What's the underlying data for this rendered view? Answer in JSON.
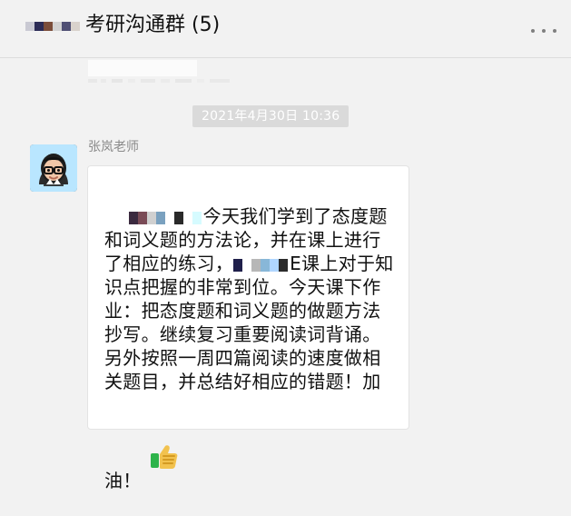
{
  "header": {
    "title": "考研沟通群 (5)",
    "more_icon": "ellipsis-horizontal-icon"
  },
  "timestamp": {
    "text": "2021年4月30日 10:36"
  },
  "message": {
    "sender_name": "张岚老师",
    "avatar_icon": "teacher-avatar-icon",
    "text_parts": [
      {
        "type": "mention_redacted"
      },
      {
        "type": "text",
        "value": "今天我们学到了态度题和词义题的方法论，并在课上进行了相应的练习，"
      },
      {
        "type": "mention_redacted"
      },
      {
        "type": "text",
        "value": "E课上对于知识点把握的非常到位。今天课下作业：把态度题和词义题的做题方法抄写。继续复习重要阅读词背诵。另外按照一周四篇阅读的速度做相关题目，并总结好相应的错题！加油！"
      }
    ],
    "emoji_icon": "thumbs-up-icon"
  },
  "colors": {
    "background": "#f2f2f2",
    "bubble": "#ffffff",
    "muted_text": "#8a8a8a",
    "time_chip_bg": "#dadada"
  }
}
